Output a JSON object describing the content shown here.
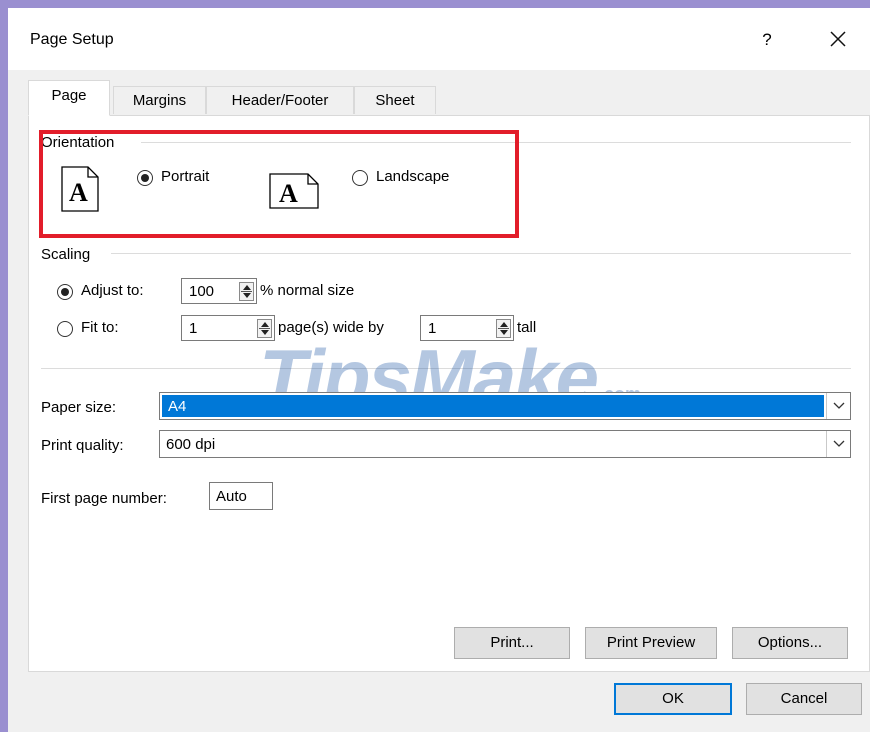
{
  "window": {
    "title": "Page Setup",
    "help_label": "?"
  },
  "tabs": [
    {
      "label": "Page",
      "active": true
    },
    {
      "label": "Margins",
      "active": false
    },
    {
      "label": "Header/Footer",
      "active": false
    },
    {
      "label": "Sheet",
      "active": false
    }
  ],
  "orientation": {
    "group_label": "Orientation",
    "portrait_label": "Portrait",
    "landscape_label": "Landscape",
    "selected": "portrait",
    "page_icon_letter": "A"
  },
  "scaling": {
    "group_label": "Scaling",
    "adjust_label": "Adjust to:",
    "adjust_value": "100",
    "adjust_suffix": "% normal size",
    "fit_label": "Fit to:",
    "fit_wide_value": "1",
    "fit_wide_suffix": "page(s) wide by",
    "fit_tall_value": "1",
    "fit_tall_suffix": "tall",
    "selected": "adjust"
  },
  "paper_size": {
    "label": "Paper size:",
    "value": "A4"
  },
  "print_quality": {
    "label": "Print quality:",
    "value": "600 dpi"
  },
  "first_page": {
    "label": "First page number:",
    "value": "Auto"
  },
  "actions": {
    "print_label": "Print...",
    "preview_label": "Print Preview",
    "options_label": "Options...",
    "ok_label": "OK",
    "cancel_label": "Cancel"
  },
  "watermark": {
    "text": "TipsMake",
    "suffix": ".com"
  },
  "colors": {
    "highlight": "#e21d2a",
    "selection": "#0078d7",
    "frame": "#9a8fd0"
  }
}
